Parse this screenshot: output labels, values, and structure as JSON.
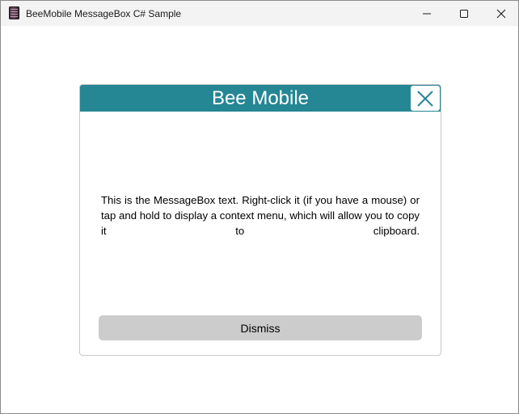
{
  "window": {
    "title": "BeeMobile MessageBox C# Sample",
    "icon": "app-book-icon",
    "controls": [
      "minimize-icon",
      "maximize-icon",
      "close-icon"
    ]
  },
  "messagebox": {
    "title": "Bee Mobile",
    "message": "This is the MessageBox text. Right-click it (if you have a mouse) or tap and hold to display a context menu, which will allow you to copy it to clipboard.",
    "dismiss_label": "Dismiss",
    "close_icon": "close-icon"
  },
  "colors": {
    "header": "#258694",
    "button": "#cccccc",
    "titlebar": "#f3f3f3"
  }
}
